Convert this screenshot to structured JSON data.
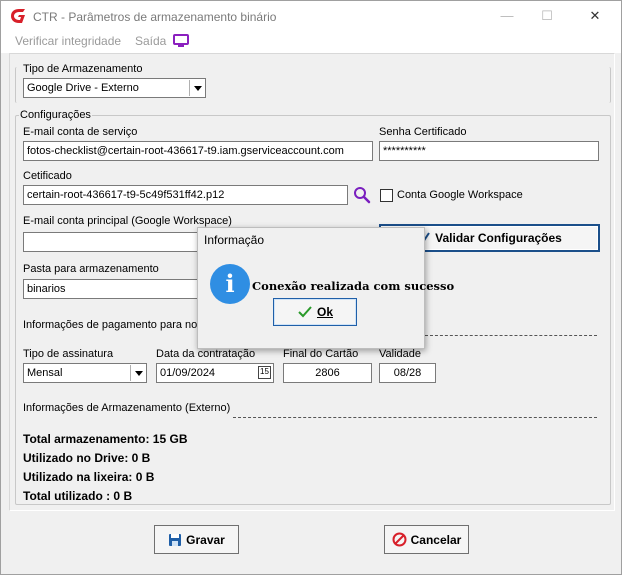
{
  "window": {
    "title": "CTR - Parâmetros de armazenamento binário",
    "minimize": "—",
    "maximize": "☐",
    "close": "✕"
  },
  "menu": {
    "items": [
      "Verificar integridade",
      "Saída"
    ]
  },
  "storage_type": {
    "label": "Tipo de Armazenamento",
    "selected": "Google Drive - Externo"
  },
  "config": {
    "group_title": "Configurações",
    "service_email_label": "E-mail conta de serviço",
    "service_email_value": "fotos-checklist@certain-root-436617-t9.iam.gserviceaccount.com",
    "cert_password_label": "Senha Certificado",
    "cert_password_value": "**********",
    "certificate_label": "Cetificado",
    "certificate_value": "certain-root-436617-t9-5c49f531ff42.p12",
    "workspace_checkbox_label": "Conta Google Workspace",
    "main_email_label": "E-mail conta principal (Google Workspace)",
    "main_email_value": "",
    "validate_button": "Validar Configurações",
    "folder_label": "Pasta para armazenamento",
    "folder_value": "binarios"
  },
  "payment": {
    "section_label": "Informações de pagamento para not",
    "subscription_label": "Tipo de assinatura",
    "subscription_value": "Mensal",
    "contract_date_label": "Data da contratação",
    "contract_date_value": "01/09/2024",
    "card_end_label": "Final do Cartão",
    "card_end_value": "2806",
    "validity_label": "Validade",
    "validity_value": "08/28"
  },
  "storage_info": {
    "section_label": "Informações de Armazenamento (Externo)",
    "total_storage": "Total armazenamento: 15 GB",
    "used_drive": "Utilizado no Drive: 0 B",
    "used_trash": "Utilizado na lixeira: 0 B",
    "total_used": "Total utilizado : 0 B"
  },
  "footer": {
    "save_label": "Gravar",
    "cancel_label": "Cancelar"
  },
  "dialog": {
    "title": "Informação",
    "icon_glyph": "i",
    "message": "Conexão realizada com sucesso",
    "ok_label": "Ok"
  },
  "colors": {
    "brand_red": "#d8202a",
    "menu_monitor": "#8b1fbf",
    "info_blue": "#2f8ee3",
    "ok_green": "#2a9a2a"
  }
}
